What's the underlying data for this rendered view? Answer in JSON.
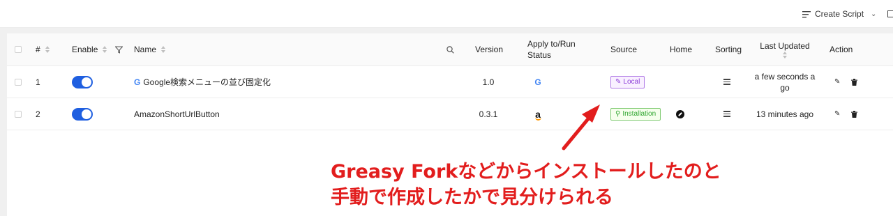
{
  "toolbar": {
    "create_label": "Create Script"
  },
  "columns": {
    "num": "#",
    "enable": "Enable",
    "name": "Name",
    "version": "Version",
    "apply_line1": "Apply to/Run",
    "apply_line2": "Status",
    "source": "Source",
    "home": "Home",
    "sorting": "Sorting",
    "updated": "Last Updated",
    "action": "Action"
  },
  "rows": [
    {
      "num": "1",
      "name": "Google検索メニューの並び固定化",
      "version": "1.0",
      "apply_icon": "G",
      "source": "Local",
      "updated_line1": "a few seconds a",
      "updated_line2": "go",
      "enabled": true
    },
    {
      "num": "2",
      "name": "AmazonShortUrlButton",
      "version": "0.3.1",
      "apply_icon": "a",
      "source": "Installation",
      "updated_line1": "13 minutes ago",
      "updated_line2": "",
      "enabled": true
    }
  ],
  "annotation": {
    "line1": "Greasy Forkなどからインストールしたのと",
    "line2": "手動で作成したかで見分けられる",
    "color": "#e21d1d"
  },
  "colors": {
    "toggle": "#1f5fe0",
    "local_tag": "#8b3dd8",
    "installation_tag": "#2ea52e"
  }
}
